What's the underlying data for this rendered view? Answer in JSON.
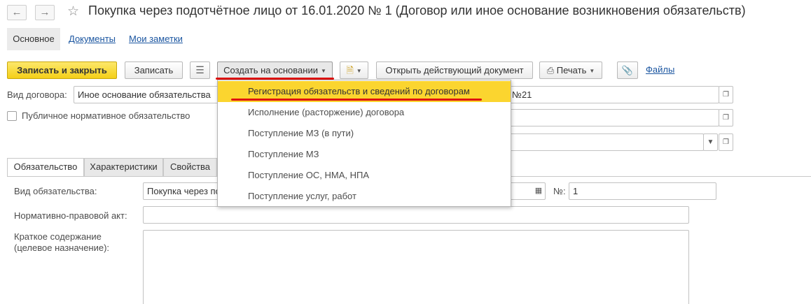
{
  "header": {
    "back_icon": "arrow-left-icon",
    "forward_icon": "arrow-right-icon",
    "star_icon": "star-outline-icon",
    "title": "Покупка через подотчётное лицо от 16.01.2020 № 1 (Договор или иное основание возникновения обязательств)"
  },
  "sections": {
    "main": "Основное",
    "documents": "Документы",
    "notes": "Мои заметки"
  },
  "toolbar": {
    "save_close": "Записать и закрыть",
    "save": "Записать",
    "create_based": "Создать на основании",
    "open_current": "Открыть действующий документ",
    "print": "Печать",
    "files": "Файлы"
  },
  "form": {
    "contract_type_label": "Вид договора:",
    "contract_type_value": "Иное основание обязательства",
    "contract_number_partial": "№21",
    "public_obligation_label": "Публичное нормативное обязательство"
  },
  "tabs": {
    "obligation": "Обязательство",
    "characteristics": "Характеристики",
    "properties": "Свойства"
  },
  "obligation": {
    "type_label": "Вид обязательства:",
    "type_value": "Покупка через по",
    "number_label": "№:",
    "number_value": "1",
    "legal_act_label": "Нормативно-правовой акт:",
    "summary_label_1": "Краткое содержание",
    "summary_label_2": "(целевое назначение):"
  },
  "dropdown": {
    "items": [
      "Регистрация обязательств и сведений по договорам",
      "Исполнение (расторжение) договора",
      "Поступление МЗ (в пути)",
      "Поступление МЗ",
      "Поступление ОС, НМА, НПА",
      "Поступление услуг, работ"
    ]
  },
  "colors": {
    "accent_yellow": "#fbd52f",
    "link_blue": "#1a55a0",
    "annotation_red": "#e0130e"
  }
}
